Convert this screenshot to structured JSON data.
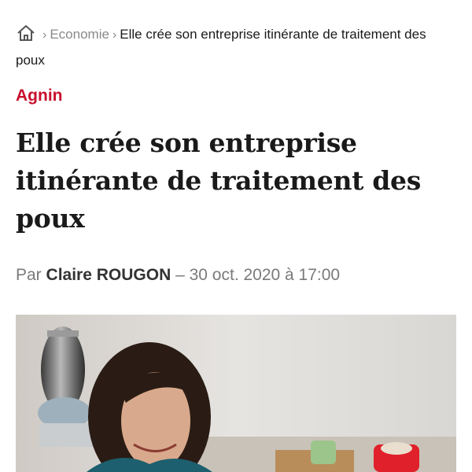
{
  "breadcrumb": {
    "home_icon": "home-icon",
    "separator": "›",
    "section": "Economie",
    "current": "Elle crée son entreprise itinérante de traitement des poux"
  },
  "article": {
    "category": "Agnin",
    "title": "Elle crée son entreprise itinérante de traitement des poux",
    "byline_prefix": "Par",
    "author": "Claire ROUGON",
    "date_separator": "–",
    "date": "30 oct. 2020 à 17:00"
  },
  "colors": {
    "category": "#c8102e",
    "muted": "#8a8a8a"
  }
}
